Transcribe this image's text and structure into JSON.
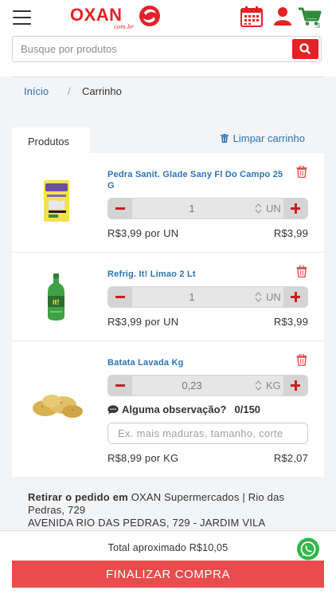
{
  "header": {
    "logo_text": "OXAN",
    "logo_sub": "com.br",
    "cart_count": "3",
    "icons": [
      "menu-icon",
      "calendar-icon",
      "user-icon",
      "cart-icon"
    ],
    "brand_color": "#e32226",
    "cart_color": "#2e8b3c"
  },
  "search": {
    "placeholder": "Busque por produtos",
    "value": ""
  },
  "breadcrumb": {
    "home": "Início",
    "separator": "/",
    "current": "Carrinho"
  },
  "cart": {
    "tab_label": "Produtos",
    "clear_label": "Limpar carrinho",
    "items": [
      {
        "name": "Pedra Sanit. Glade Sany Fl Do Campo 25 G",
        "qty": "1",
        "unit": "UN",
        "unit_price": "R$3,99 por UN",
        "total": "R$3,99"
      },
      {
        "name": "Refrig. It! Limao 2 Lt",
        "qty": "1",
        "unit": "UN",
        "unit_price": "R$3,99 por UN",
        "total": "R$3,99"
      },
      {
        "name": "Batata Lavada Kg",
        "qty": "0,23",
        "unit": "KG",
        "unit_price": "R$8,99 por KG",
        "total": "R$2,07",
        "obs_label": "Alguma observação?",
        "obs_count": "0/150",
        "obs_placeholder": "Ex. mais maduras, tamanho, corte"
      }
    ]
  },
  "pickup": {
    "label": "Retirar o pedido em",
    "store": "OXAN Supermercados | Rio das Pedras, 729",
    "address": "AVENIDA RIO DAS PEDRAS, 729 - JARDIM VILA"
  },
  "footer": {
    "total_text": "Total aproximado R$10,05",
    "checkout_label": "FINALIZAR COMPRA",
    "button_color": "#e84c4c"
  }
}
